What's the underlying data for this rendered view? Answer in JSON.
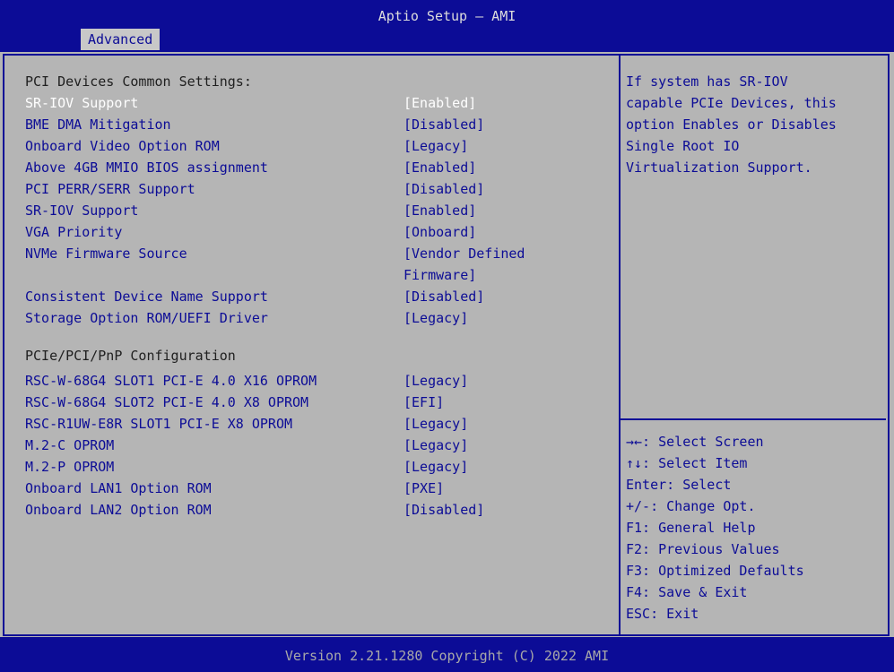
{
  "window": {
    "title": "Aptio Setup – AMI",
    "active_tab": "Advanced"
  },
  "sections": {
    "pci_common": "PCI Devices Common Settings:",
    "pnp_config": "PCIe/PCI/PnP Configuration"
  },
  "settings": [
    {
      "label": "SR-IOV Support",
      "value": "[Enabled]",
      "selected": true
    },
    {
      "label": "BME DMA Mitigation",
      "value": "[Disabled]"
    },
    {
      "label": "Onboard Video Option ROM",
      "value": "[Legacy]"
    },
    {
      "label": "Above 4GB MMIO BIOS assignment",
      "value": "[Enabled]"
    },
    {
      "label": "PCI PERR/SERR Support",
      "value": "[Disabled]"
    },
    {
      "label": "SR-IOV Support",
      "value": "[Enabled]"
    },
    {
      "label": "VGA Priority",
      "value": "[Onboard]"
    },
    {
      "label": "NVMe Firmware Source",
      "value": "[Vendor Defined\nFirmware]"
    },
    {
      "label": "Consistent Device Name Support",
      "value": "[Disabled]"
    },
    {
      "label": "Storage Option ROM/UEFI Driver",
      "value": "[Legacy]"
    },
    {
      "label": "RSC-W-68G4 SLOT1 PCI-E 4.0 X16 OPROM",
      "value": "[Legacy]"
    },
    {
      "label": "RSC-W-68G4 SLOT2 PCI-E 4.0 X8 OPROM",
      "value": "[EFI]"
    },
    {
      "label": "RSC-R1UW-E8R SLOT1 PCI-E X8 OPROM",
      "value": "[Legacy]"
    },
    {
      "label": "M.2-C OPROM",
      "value": "[Legacy]"
    },
    {
      "label": "M.2-P OPROM",
      "value": "[Legacy]"
    },
    {
      "label": "Onboard LAN1 Option ROM",
      "value": "[PXE]"
    },
    {
      "label": "Onboard LAN2 Option ROM",
      "value": "[Disabled]"
    }
  ],
  "help": {
    "lines": [
      "If system has SR-IOV",
      "capable PCIe Devices, this",
      "option Enables or Disables",
      "Single Root IO",
      "Virtualization Support."
    ]
  },
  "keys": [
    "→←: Select Screen",
    "↑↓: Select Item",
    "Enter: Select",
    "+/-: Change Opt.",
    "F1: General Help",
    "F2: Previous Values",
    "F3: Optimized Defaults",
    "F4: Save & Exit",
    "ESC: Exit"
  ],
  "footer": {
    "version": "Version 2.21.1280 Copyright (C) 2022 AMI"
  },
  "colors": {
    "header_blue": "#0c0c96",
    "panel_gray": "#b5b5b5",
    "highlight": "#ffffff"
  }
}
